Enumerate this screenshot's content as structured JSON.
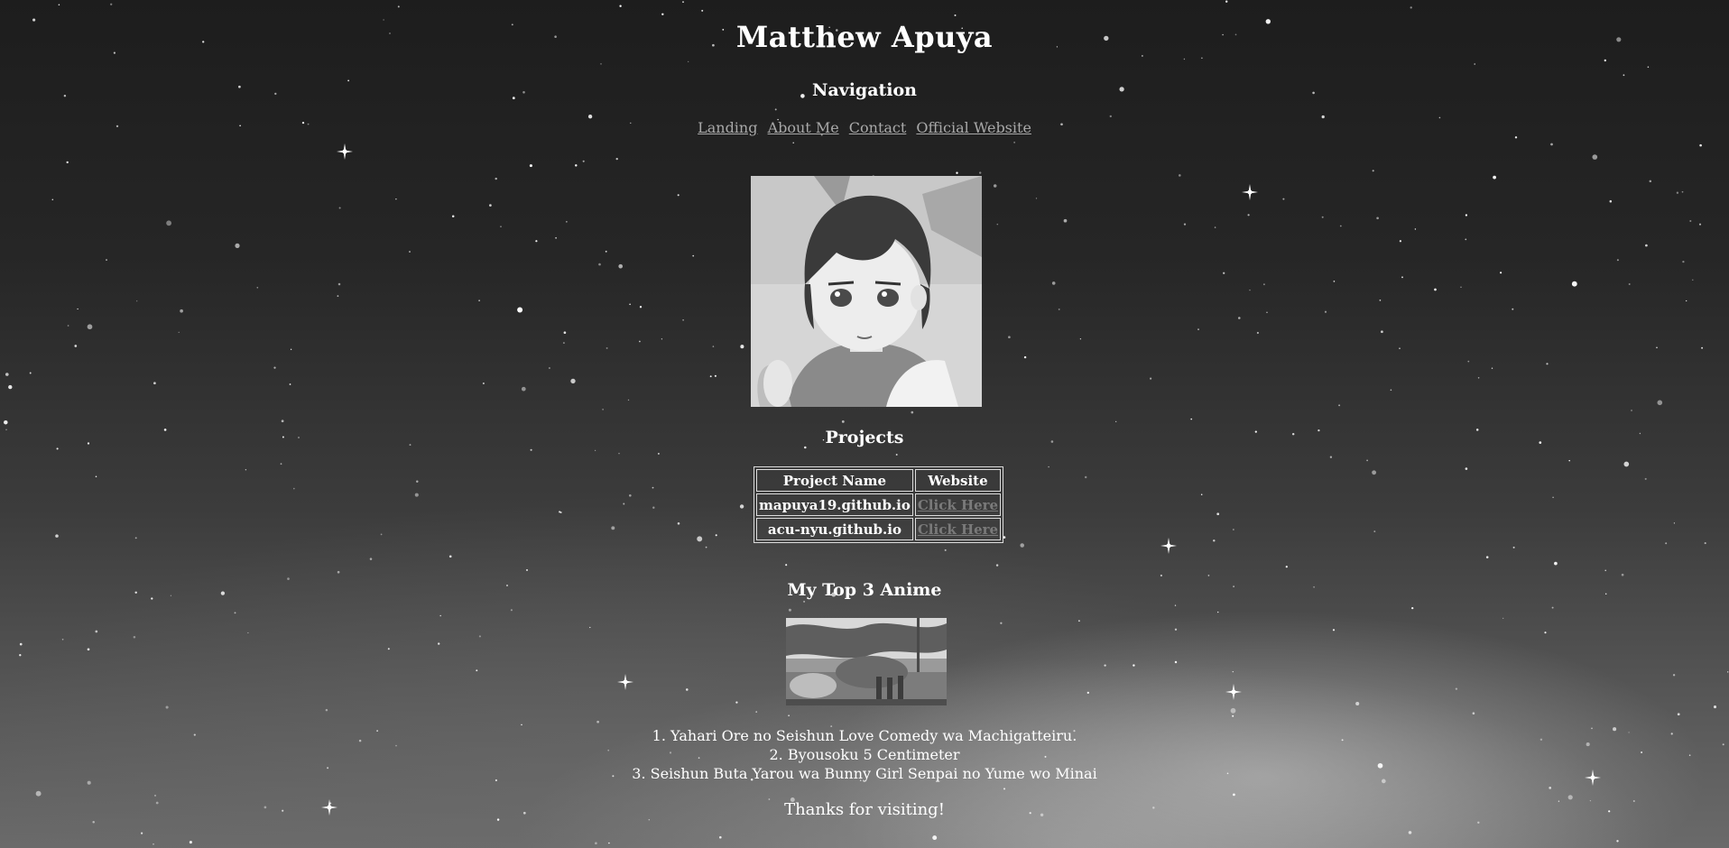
{
  "header": {
    "title": "Matthew Apuya"
  },
  "navigation": {
    "heading": "Navigation",
    "links": [
      {
        "label": "Landing"
      },
      {
        "label": "About Me"
      },
      {
        "label": "Contact"
      },
      {
        "label": "Official Website"
      }
    ]
  },
  "avatar": {
    "icon": "profile-avatar-image"
  },
  "projects": {
    "heading": "Projects",
    "columns": [
      "Project Name",
      "Website"
    ],
    "rows": [
      {
        "name": "mapuya19.github.io",
        "link": "Click Here"
      },
      {
        "name": "acu-nyu.github.io",
        "link": "Click Here"
      }
    ]
  },
  "anime": {
    "heading": "My Top 3 Anime",
    "image": "anime-scene-image",
    "list": [
      "1. Yahari Ore no Seishun Love Comedy wa Machigatteiru.",
      "2. Byousoku 5 Centimeter",
      "3. Seishun Buta Yarou wa Bunny Girl Senpai no Yume wo Minai"
    ]
  },
  "footer": {
    "thanks": "Thanks for visiting!"
  },
  "colors": {
    "link": "#a9a9a9",
    "table_link": "#7a7a7a",
    "text": "#ffffff"
  }
}
